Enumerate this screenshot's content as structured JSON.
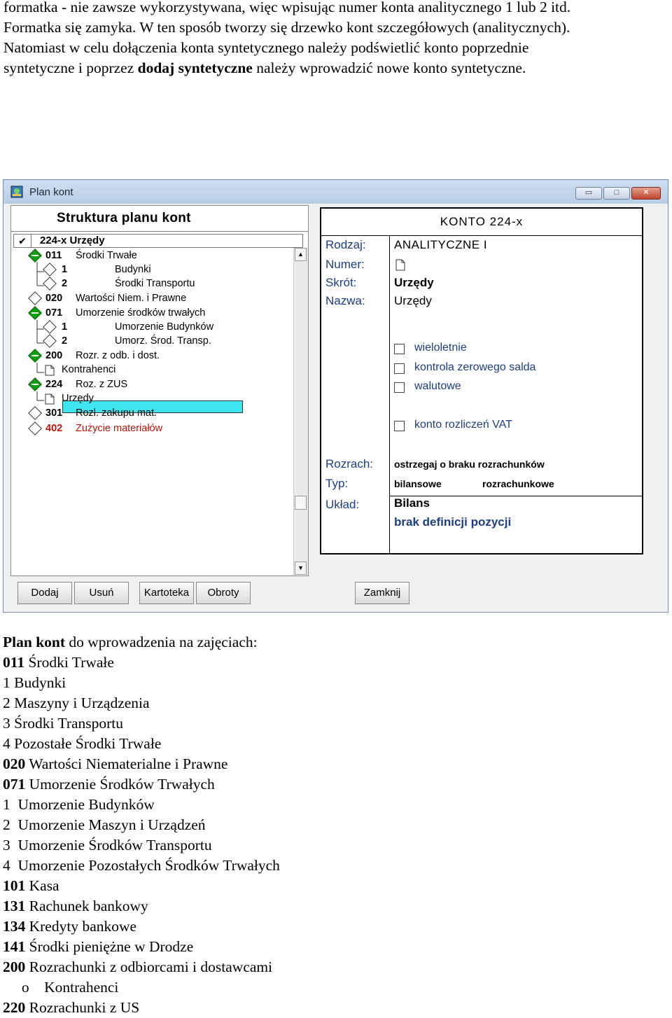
{
  "intro": {
    "line1": "formatka - nie zawsze wykorzystywana, więc wpisując numer konta analitycznego 1 lub 2 itd.",
    "line2": "Formatka się zamyka. W ten sposób tworzy się drzewko kont szczegółowych (analitycznych).",
    "line3": "Natomiast w celu dołączenia konta syntetycznego należy podświetlić konto poprzednie",
    "line4_pre": "syntetyczne i poprzez ",
    "line4_bold": "dodaj syntetyczne",
    "line4_post": " należy wprowadzić nowe konto syntetyczne."
  },
  "window": {
    "title": "Plan kont",
    "minimize": "▭",
    "maximize": "□",
    "close": "✕"
  },
  "left": {
    "header": "Struktura planu kont",
    "path_check": "✔",
    "path": "224-x    Urzędy",
    "tree": [
      {
        "code": "011",
        "name": "Środki Trwałe",
        "expanded": true,
        "red": false
      },
      {
        "code": "1",
        "name": "Budynki",
        "leaf": true
      },
      {
        "code": "2",
        "name": "Środki Transportu",
        "leaf": true
      },
      {
        "code": "020",
        "name": "Wartości Niem. i Prawne",
        "expanded": false,
        "red": false
      },
      {
        "code": "071",
        "name": "Umorzenie środków trwałych",
        "expanded": true,
        "red": false
      },
      {
        "code": "1",
        "name": "Umorzenie Budynków",
        "leaf": true
      },
      {
        "code": "2",
        "name": "Umorz. Środ. Transp.",
        "leaf": true
      },
      {
        "code": "200",
        "name": "Rozr. z odb. i dost.",
        "expanded": true,
        "red": false
      },
      {
        "code": "",
        "name": "Kontrahenci",
        "doc": true
      },
      {
        "code": "224",
        "name": "Roz. z ZUS",
        "expanded": true,
        "red": false
      },
      {
        "code": "",
        "name": "Urzędy",
        "doc": true,
        "selected": true
      },
      {
        "code": "301",
        "name": "Rozl. zakupu mat.",
        "expanded": false,
        "red": false
      },
      {
        "code": "402",
        "name": "Zużycie materiałów",
        "expanded": false,
        "red": true
      }
    ]
  },
  "right": {
    "header": "KONTO  224-x",
    "rodzaj_label": "Rodzaj:",
    "rodzaj_value": "ANALITYCZNE    I",
    "numer_label": "Numer:",
    "numer_icon": "document-icon",
    "skrot_label": "Skrót:",
    "skrot_value": "Urzędy",
    "nazwa_label": "Nazwa:",
    "nazwa_value": "Urzędy",
    "checkboxes": [
      "wieloletnie",
      "kontrola zerowego salda",
      "walutowe",
      "konto rozliczeń VAT"
    ],
    "rozrach_label": "Rozrach:",
    "rozrach_value": "ostrzegaj o braku rozrachunków",
    "typ_label": "Typ:",
    "typ_value1": "bilansowe",
    "typ_value2": "rozrachunkowe",
    "uklad_label": "Układ:",
    "uklad_value": "Bilans",
    "uklad_note": "brak definicji pozycji"
  },
  "buttons": {
    "dodaj": "Dodaj",
    "usun": "Usuń",
    "kartoteka": "Kartoteka",
    "obroty": "Obroty",
    "zamknij": "Zamknij"
  },
  "plan": {
    "heading_bold": "Plan kont",
    "heading_rest": "  do wprowadzenia na zajęciach:",
    "items": [
      {
        "code": "011",
        "text": " Środki Trwałe",
        "bold": true
      },
      {
        "code": "1",
        "text": " Budynki",
        "bold": false
      },
      {
        "code": "2",
        "text": " Maszyny i Urządzenia",
        "bold": false
      },
      {
        "code": "3",
        "text": " Środki Transportu",
        "bold": false
      },
      {
        "code": "4",
        "text": " Pozostałe Środki Trwałe",
        "bold": false
      },
      {
        "code": "020",
        "text": " Wartości Niematerialne i Prawne",
        "bold": true
      },
      {
        "code": "071",
        "text": " Umorzenie Środków Trwałych",
        "bold": true
      },
      {
        "code": "1",
        "text": "  Umorzenie Budynków",
        "bold": false
      },
      {
        "code": "2",
        "text": "  Umorzenie Maszyn i Urządzeń",
        "bold": false
      },
      {
        "code": "3",
        "text": "  Umorzenie Środków Transportu",
        "bold": false
      },
      {
        "code": "4",
        "text": "  Umorzenie Pozostałych Środków Trwałych",
        "bold": false
      },
      {
        "code": "101",
        "text": " Kasa",
        "bold": true
      },
      {
        "code": "131",
        "text": " Rachunek bankowy",
        "bold": true
      },
      {
        "code": "134",
        "text": " Kredyty bankowe",
        "bold": true
      },
      {
        "code": "141",
        "text": " Środki pieniężne w Drodze",
        "bold": true
      },
      {
        "code": "200",
        "text": " Rozrachunki z odbiorcami i dostawcami",
        "bold": true
      },
      {
        "code": "     o",
        "text": "    Kontrahenci",
        "bold": false
      },
      {
        "code": "220",
        "text": " Rozrachunki z US",
        "bold": true
      }
    ]
  }
}
